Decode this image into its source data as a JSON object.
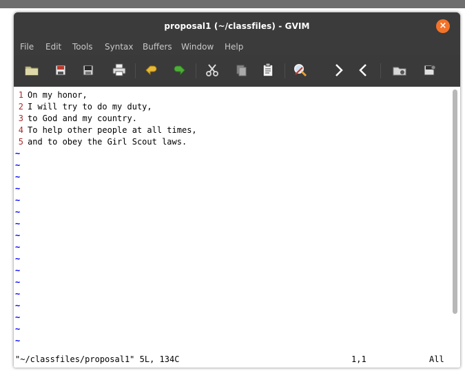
{
  "window": {
    "title": "proposal1 (~/classfiles) - GVIM",
    "close_label": "×"
  },
  "menu": [
    "File",
    "Edit",
    "Tools",
    "Syntax",
    "Buffers",
    "Window",
    "Help"
  ],
  "toolbar": {
    "icons": [
      "open-folder-icon",
      "save-icon",
      "save-all-icon",
      "print-icon",
      "undo-icon",
      "redo-icon",
      "cut-icon",
      "copy-icon",
      "paste-icon",
      "find-replace-icon",
      "next-icon",
      "previous-icon",
      "load-session-icon",
      "save-session-icon"
    ]
  },
  "buffer": {
    "lines": [
      {
        "num": "1",
        "text": "On my honor,"
      },
      {
        "num": "2",
        "text": "I will try to do my duty,"
      },
      {
        "num": "3",
        "text": "to God and my country."
      },
      {
        "num": "4",
        "text": "To help other people at all times,"
      },
      {
        "num": "5",
        "text": "and to obey the Girl Scout laws."
      }
    ],
    "tilde": "~"
  },
  "status": {
    "file_info": "\"~/classfiles/proposal1\" 5L, 134C",
    "cursor": "1,1",
    "scroll": "All"
  },
  "colors": {
    "titlebar": "#3b3b3b",
    "close": "#f37329",
    "line_number": "#a52a2a",
    "tilde": "#0000ff"
  }
}
